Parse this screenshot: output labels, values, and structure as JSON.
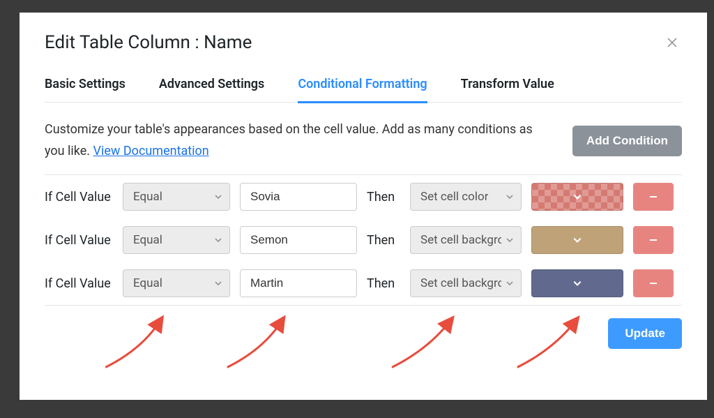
{
  "modal": {
    "title": "Edit Table Column : Name"
  },
  "tabs": {
    "basic": "Basic Settings",
    "advanced": "Advanced Settings",
    "conditional": "Conditional Formatting",
    "transform": "Transform Value"
  },
  "description": {
    "text_before": "Customize your table's appearances based on the cell value. Add as many conditions as you like. ",
    "link": "View Documentation"
  },
  "buttons": {
    "add_condition": "Add Condition",
    "update": "Update"
  },
  "labels": {
    "if_cell_value": "If Cell Value",
    "then": "Then"
  },
  "conditions": [
    {
      "operator": "Equal",
      "value": "Sovia",
      "action": "Set cell color",
      "color": "#d57a72",
      "checker": true
    },
    {
      "operator": "Equal",
      "value": "Semon",
      "action": "Set cell background",
      "color": "#bfa278",
      "checker": false
    },
    {
      "operator": "Equal",
      "value": "Martin",
      "action": "Set cell background",
      "color": "#616a8e",
      "checker": false
    }
  ]
}
